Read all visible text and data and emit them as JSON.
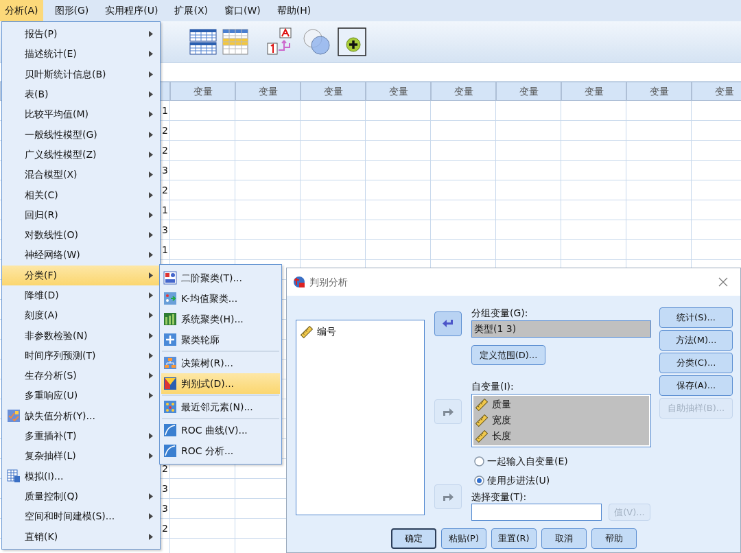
{
  "menubar": [
    {
      "label": "分析(A)",
      "selected": true
    },
    {
      "label": "图形(G)",
      "selected": false
    },
    {
      "label": "实用程序(U)",
      "selected": false
    },
    {
      "label": "扩展(X)",
      "selected": false
    },
    {
      "label": "窗口(W)",
      "selected": false
    },
    {
      "label": "帮助(H)",
      "selected": false
    }
  ],
  "grid": {
    "columns": [
      "变量",
      "变量",
      "变量",
      "变量",
      "变量",
      "变量",
      "变量",
      "变量",
      "变量"
    ],
    "rows": [
      {
        "value": "1"
      },
      {
        "value": "2"
      },
      {
        "value": "2"
      },
      {
        "value": "3"
      },
      {
        "value": "2"
      },
      {
        "value": "1"
      },
      {
        "value": "3"
      },
      {
        "value": "1"
      },
      {},
      {},
      {},
      {},
      {},
      {},
      {},
      {},
      {},
      {},
      {
        "value": "2"
      },
      {
        "value": "3"
      },
      {
        "value": "3"
      },
      {
        "value": "2"
      },
      {}
    ]
  },
  "analyze_menu": [
    {
      "label": "报告(P)",
      "kind": "submenu",
      "selected": false
    },
    {
      "label": "描述统计(E)",
      "kind": "submenu",
      "selected": false
    },
    {
      "label": "贝叶斯统计信息(B)",
      "kind": "submenu",
      "selected": false
    },
    {
      "label": "表(B)",
      "kind": "submenu",
      "selected": false
    },
    {
      "label": "比较平均值(M)",
      "kind": "submenu",
      "selected": false
    },
    {
      "label": "一般线性模型(G)",
      "kind": "submenu",
      "selected": false
    },
    {
      "label": "广义线性模型(Z)",
      "kind": "submenu",
      "selected": false
    },
    {
      "label": "混合模型(X)",
      "kind": "submenu",
      "selected": false
    },
    {
      "label": "相关(C)",
      "kind": "submenu",
      "selected": false
    },
    {
      "label": "回归(R)",
      "kind": "submenu",
      "selected": false
    },
    {
      "label": "对数线性(O)",
      "kind": "submenu",
      "selected": false
    },
    {
      "label": "神经网络(W)",
      "kind": "submenu",
      "selected": false
    },
    {
      "label": "分类(F)",
      "kind": "submenu",
      "selected": true
    },
    {
      "label": "降维(D)",
      "kind": "submenu",
      "selected": false
    },
    {
      "label": "刻度(A)",
      "kind": "submenu",
      "selected": false
    },
    {
      "label": "非参数检验(N)",
      "kind": "submenu",
      "selected": false
    },
    {
      "label": "时间序列预测(T)",
      "kind": "submenu",
      "selected": false
    },
    {
      "label": "生存分析(S)",
      "kind": "submenu",
      "selected": false
    },
    {
      "label": "多重响应(U)",
      "kind": "submenu",
      "selected": false
    },
    {
      "label": "缺失值分析(Y)...",
      "kind": "missing_values",
      "selected": false
    },
    {
      "label": "多重插补(T)",
      "kind": "submenu",
      "selected": false
    },
    {
      "label": "复杂抽样(L)",
      "kind": "submenu",
      "selected": false
    },
    {
      "label": "模拟(I)...",
      "kind": "simulation",
      "selected": false
    },
    {
      "label": "质量控制(Q)",
      "kind": "submenu",
      "selected": false
    },
    {
      "label": "空间和时间建模(S)...",
      "kind": "submenu",
      "selected": false
    },
    {
      "label": "直销(K)",
      "kind": "submenu",
      "selected": false
    }
  ],
  "classify_menu": [
    {
      "label": "二阶聚类(T)...",
      "kind": "two_step",
      "selected": false,
      "separator_before": false
    },
    {
      "label": "K-均值聚类...",
      "kind": "kmeans",
      "selected": false,
      "separator_before": false
    },
    {
      "label": "系统聚类(H)...",
      "kind": "hierarchical",
      "selected": false,
      "separator_before": false
    },
    {
      "label": "聚类轮廓",
      "kind": "profile",
      "selected": false,
      "separator_before": false
    },
    {
      "label": "决策树(R)...",
      "kind": "tree",
      "selected": false,
      "separator_before": true
    },
    {
      "label": "判别式(D)...",
      "kind": "discriminant",
      "selected": true,
      "separator_before": false
    },
    {
      "label": "最近邻元素(N)...",
      "kind": "nearest",
      "selected": false,
      "separator_before": true
    },
    {
      "label": "ROC 曲线(V)...",
      "kind": "roc",
      "selected": false,
      "separator_before": true
    },
    {
      "label": "ROC 分析...",
      "kind": "roc",
      "selected": false,
      "separator_before": false
    }
  ],
  "dialog": {
    "title": "判别分析",
    "source_variables": [
      "编号"
    ],
    "arrow_buttons": [
      {
        "kind": "left",
        "disabled": false
      },
      {
        "kind": "right",
        "disabled": true
      },
      {
        "kind": "right",
        "disabled": true
      }
    ],
    "grouping_label": "分组变量(G):",
    "grouping_value": "类型(1 3)",
    "define_range_button": "定义范围(D)...",
    "independents_label": "自变量(I):",
    "independents": [
      "质量",
      "宽度",
      "长度"
    ],
    "radios": [
      {
        "label": "一起输入自变量(E)",
        "selected": false
      },
      {
        "label": "使用步进法(U)",
        "selected": true
      }
    ],
    "selection_label": "选择变量(T):",
    "value_button": {
      "label": "值(V)...",
      "disabled": true
    },
    "side_buttons": [
      {
        "label": "统计(S)...",
        "disabled": false
      },
      {
        "label": "方法(M)...",
        "disabled": false
      },
      {
        "label": "分类(C)...",
        "disabled": false
      },
      {
        "label": "保存(A)...",
        "disabled": false
      },
      {
        "label": "自助抽样(B)...",
        "disabled": true
      }
    ],
    "bottom_buttons": [
      {
        "label": "确定",
        "default": true
      },
      {
        "label": "粘贴(P)",
        "default": false
      },
      {
        "label": "重置(R)",
        "default": false
      },
      {
        "label": "取消",
        "default": false
      },
      {
        "label": "帮助",
        "default": false
      }
    ]
  }
}
